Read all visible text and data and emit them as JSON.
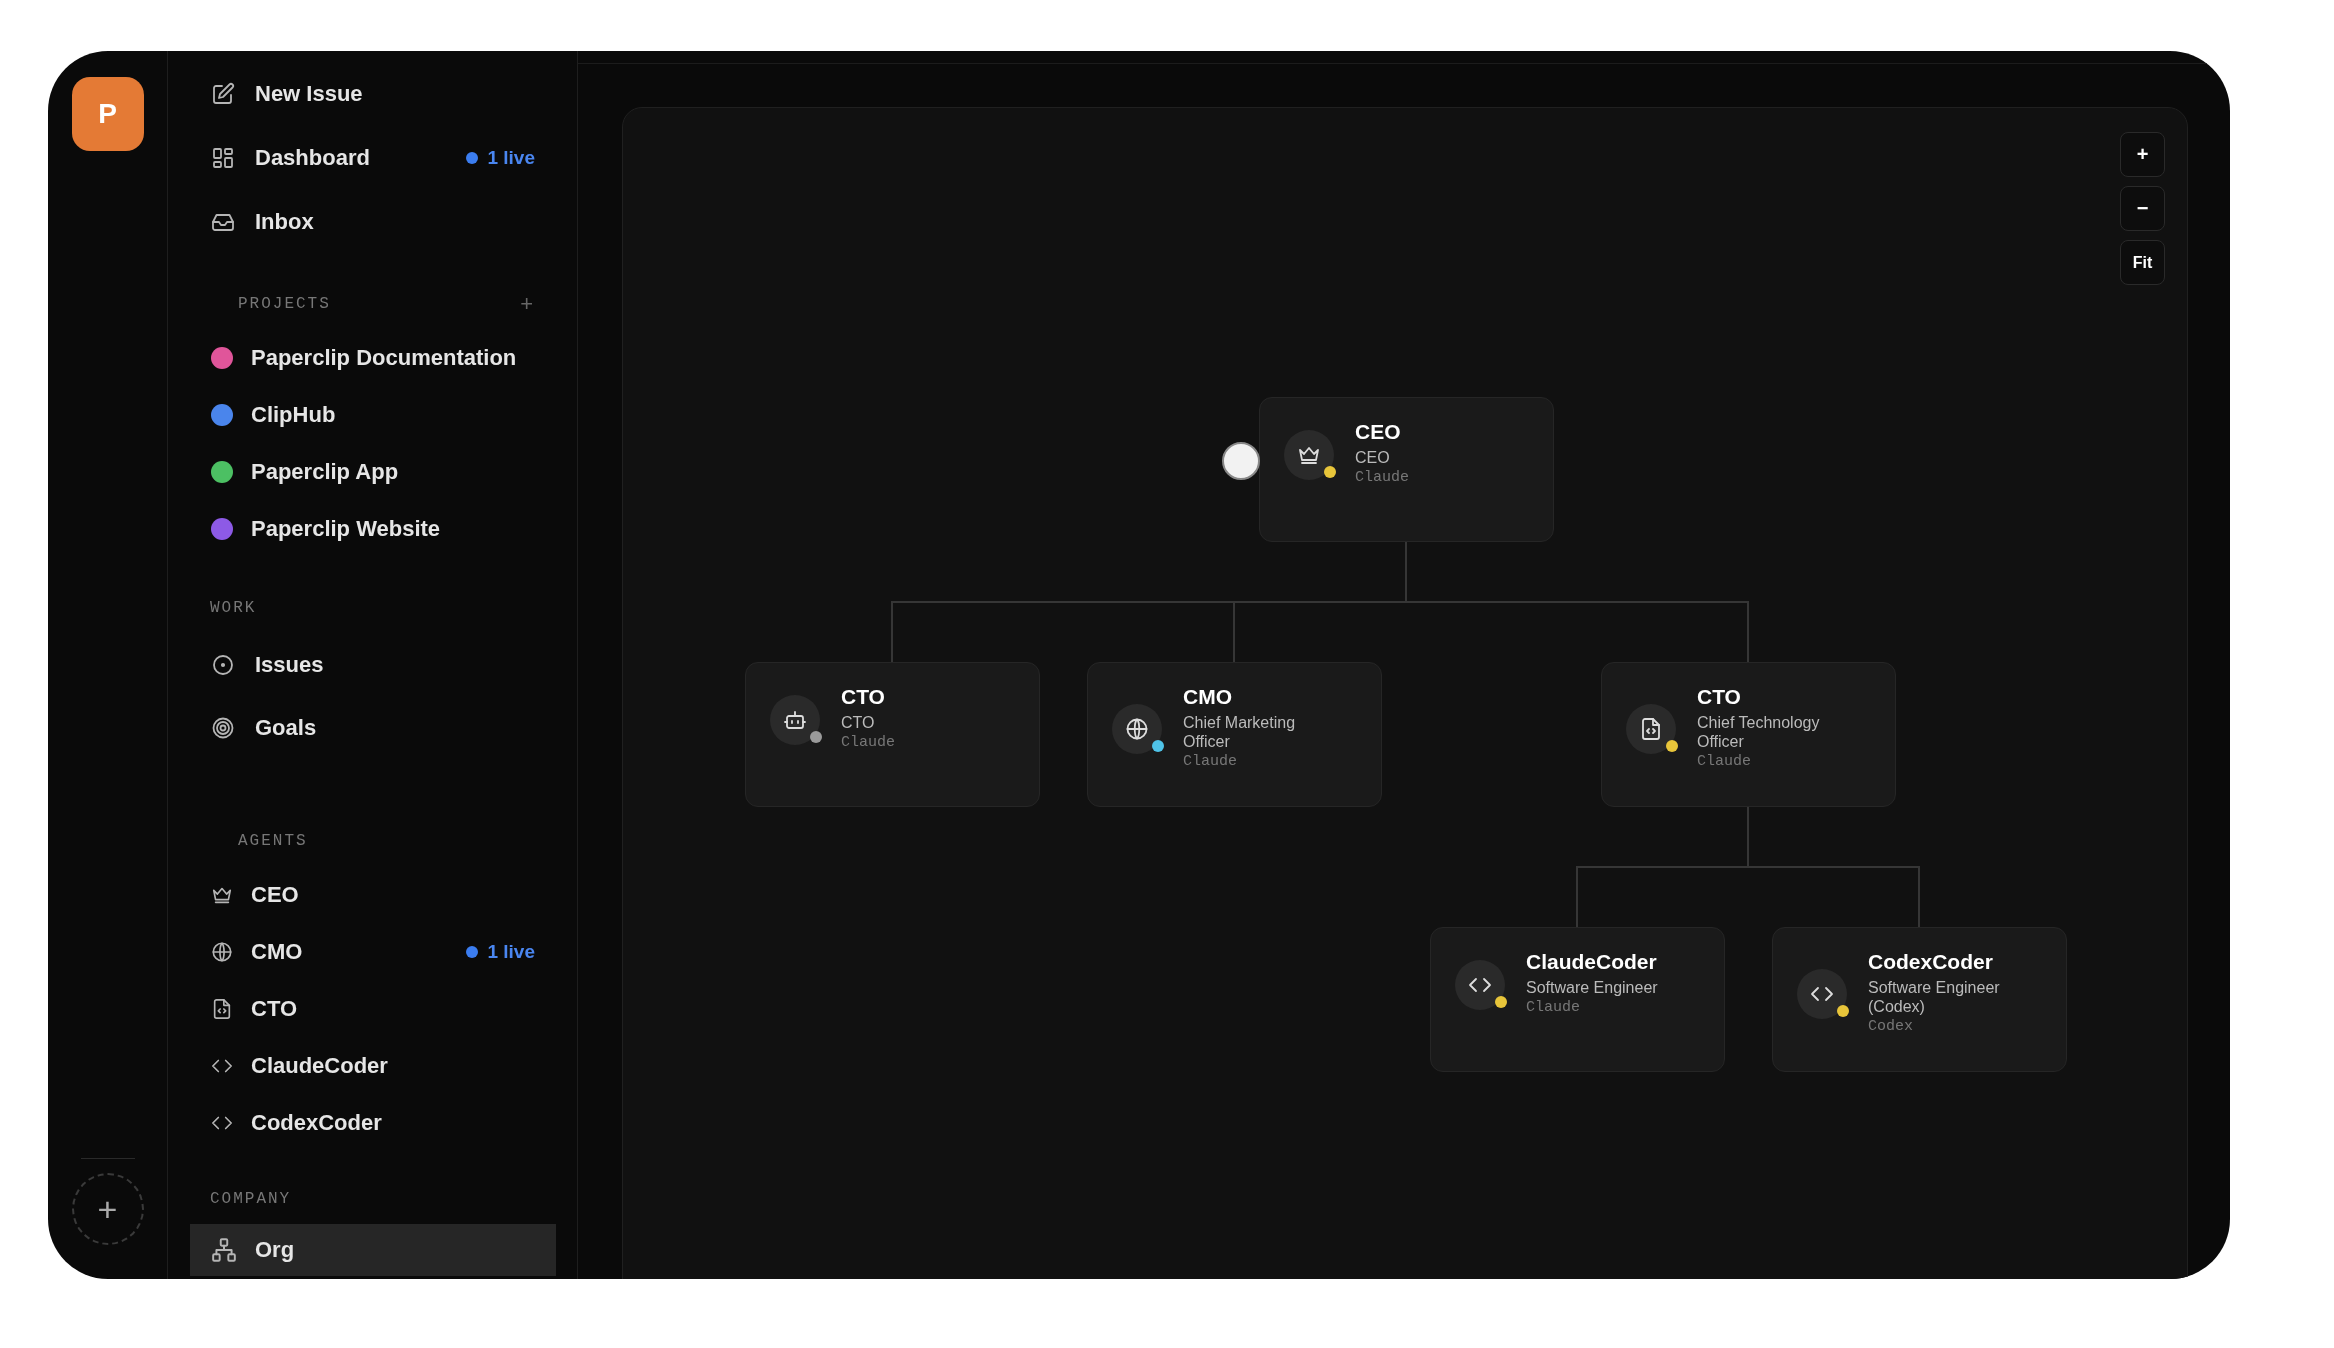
{
  "rail": {
    "logo": "P",
    "add_button": "+"
  },
  "sidebar": {
    "nav": [
      {
        "label": "New Issue",
        "selected": false
      },
      {
        "label": "Dashboard",
        "badge": "1 live",
        "selected": false
      },
      {
        "label": "Inbox",
        "selected": false
      }
    ],
    "projects": {
      "title": "PROJECTS",
      "add": "+",
      "items": [
        {
          "label": "Paperclip Documentation",
          "color": "#e0559a",
          "selected": false
        },
        {
          "label": "ClipHub",
          "color": "#4a85ec",
          "selected": false
        },
        {
          "label": "Paperclip App",
          "color": "#4cc063",
          "selected": false
        },
        {
          "label": "Paperclip Website",
          "color": "#8d5ae6",
          "selected": false
        }
      ]
    },
    "work": {
      "title": "WORK",
      "items": [
        {
          "label": "Issues",
          "selected": false
        },
        {
          "label": "Goals",
          "selected": false
        }
      ]
    },
    "agents": {
      "title": "AGENTS",
      "items": [
        {
          "label": "CEO",
          "selected": false
        },
        {
          "label": "CMO",
          "badge": "1 live",
          "selected": false
        },
        {
          "label": "CTO",
          "selected": false
        },
        {
          "label": "ClaudeCoder",
          "selected": false
        },
        {
          "label": "CodexCoder",
          "selected": false
        }
      ]
    },
    "company": {
      "title": "COMPANY",
      "items": [
        {
          "label": "Org",
          "selected": true
        }
      ]
    }
  },
  "org_chart": {
    "zoom_controls": [
      "+",
      "−",
      "Fit"
    ],
    "nodes": [
      {
        "name": "CEO",
        "role": "CEO",
        "model": "Claude",
        "color": "#e8c53a",
        "children": [
          {
            "name": "CTO",
            "role": "CTO",
            "model": "Claude",
            "color": "#9a9a9a"
          },
          {
            "name": "CMO",
            "role": "Chief Marketing Officer",
            "model": "Claude",
            "color": "#4fc3e8"
          },
          {
            "name": "CTO",
            "role": "Chief Technology Officer",
            "model": "Claude",
            "color": "#e8c53a",
            "children": [
              {
                "name": "ClaudeCoder",
                "role": "Software Engineer",
                "model": "Claude",
                "color": "#e8c53a"
              },
              {
                "name": "CodexCoder",
                "role": "Software Engineer (Codex)",
                "model": "Codex",
                "color": "#e8c53a"
              }
            ]
          }
        ]
      }
    ]
  }
}
